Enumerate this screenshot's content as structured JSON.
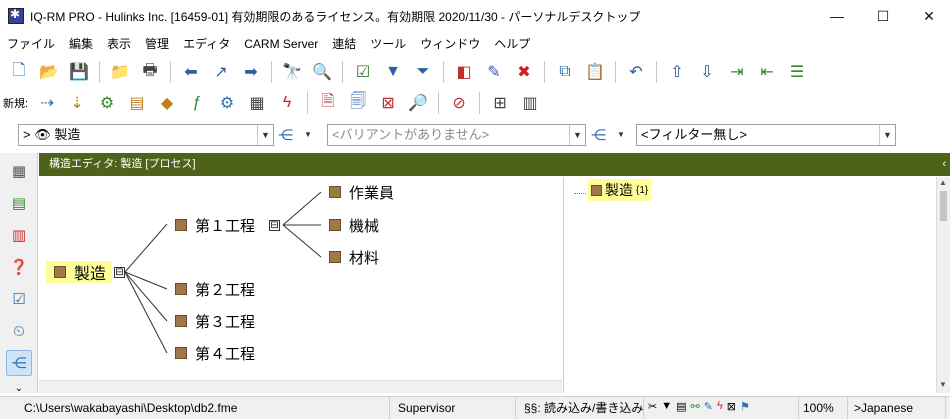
{
  "window": {
    "title": "IQ-RM PRO - Hulinks Inc. [16459-01] 有効期限のあるライセンス。有効期限 2020/11/30 - パーソナルデスクトップ",
    "minimize": "—",
    "maximize": "☐",
    "close": "✕"
  },
  "menu": [
    "ファイル",
    "編集",
    "表示",
    "管理",
    "エディタ",
    "CARM Server",
    "連結",
    "ツール",
    "ウィンドウ",
    "ヘルプ"
  ],
  "toolbar2": {
    "new_label": "新規:"
  },
  "filters": {
    "context_value": "> 👁 製造",
    "variant_placeholder": "<バリアントがありません>",
    "filter_value": "<フィルター無し>"
  },
  "panel": {
    "title": "構造エディタ: 製造 [プロセス]",
    "collapse": "‹"
  },
  "tree": {
    "root": "製造",
    "steps": [
      "第１工程",
      "第２工程",
      "第３工程",
      "第４工程"
    ],
    "step1_children": [
      "作業員",
      "機械",
      "材料"
    ],
    "expander": "⊟"
  },
  "right_tree": {
    "label": "製造",
    "count": "{1}"
  },
  "status": {
    "path": "C:\\Users\\wakabayashi\\Desktop\\db2.fme",
    "user": "Supervisor",
    "mode": "§§: 読み込み/書き込み",
    "zoom": "100%",
    "language": ">Japanese"
  },
  "colors": {
    "header_bg": "#4f6219",
    "highlight": "#ffff99",
    "node_square": "#a07848"
  }
}
